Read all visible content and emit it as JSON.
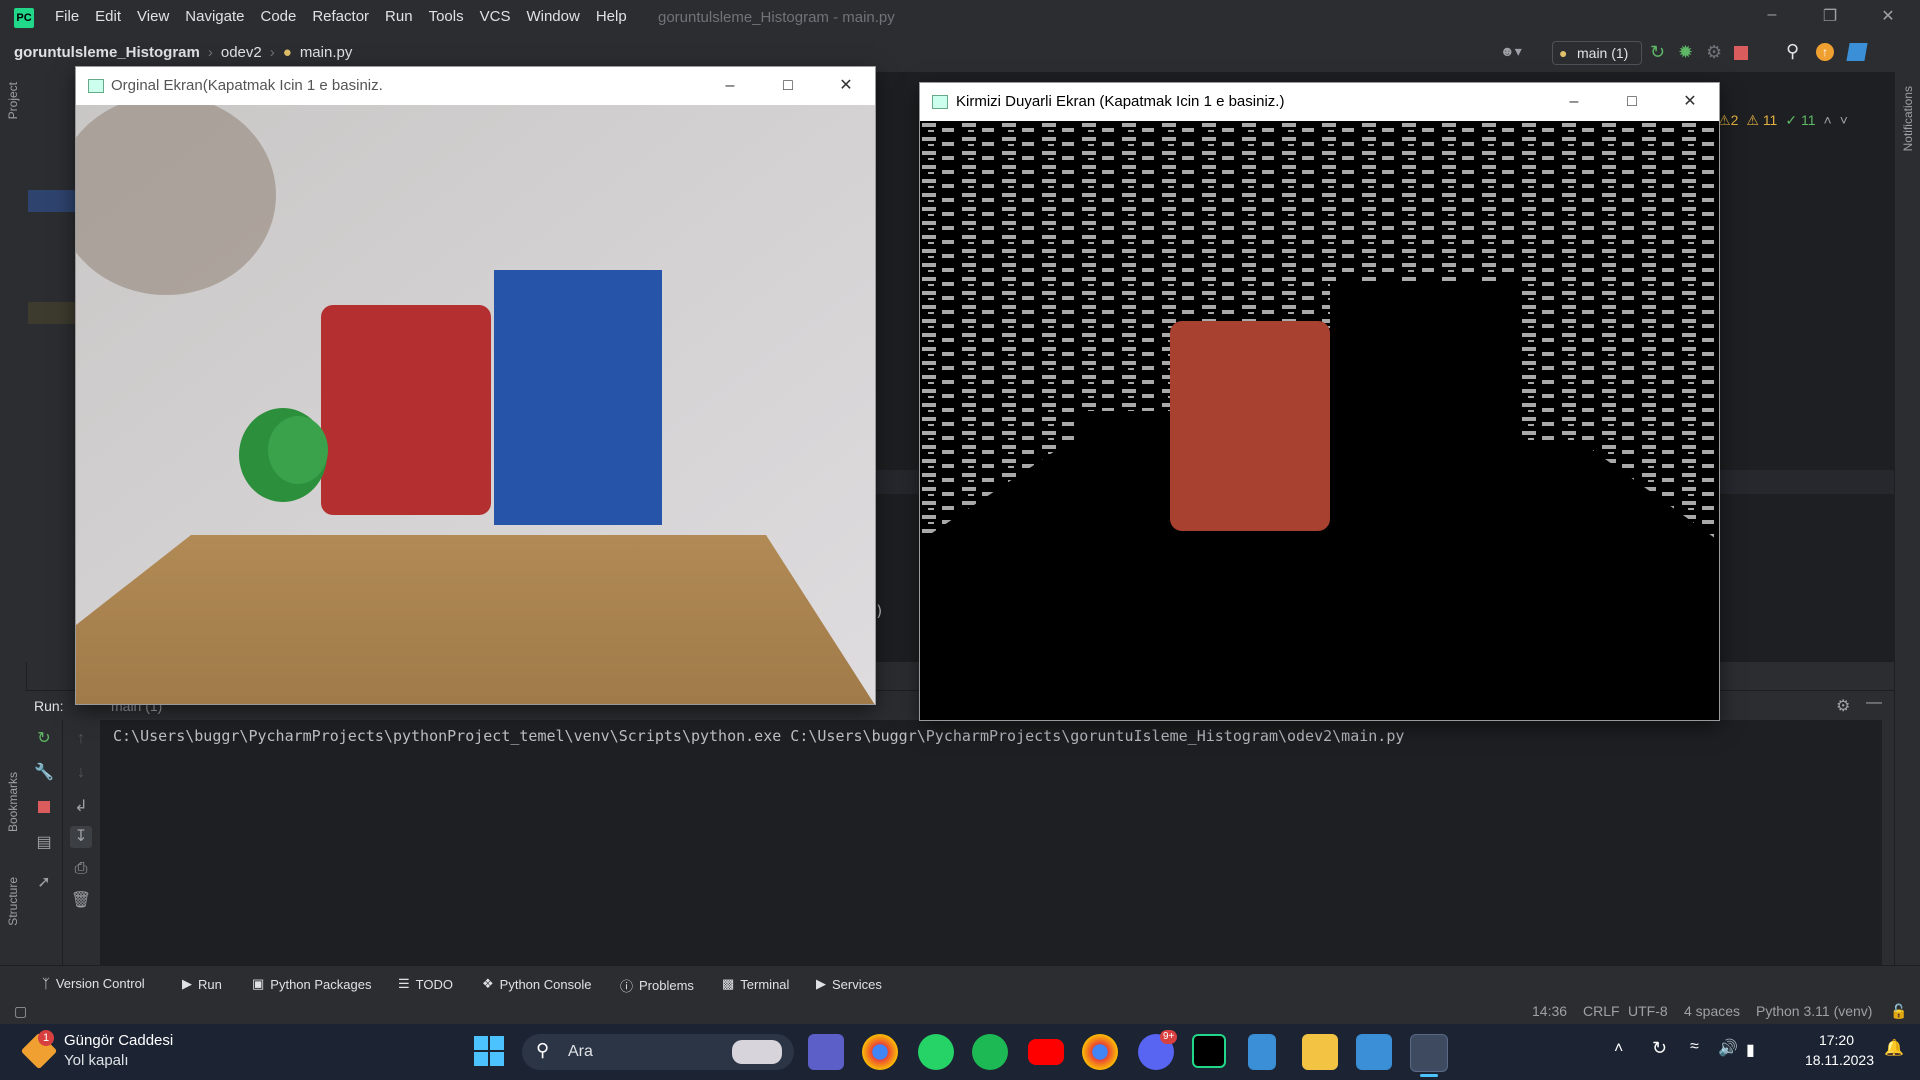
{
  "ide": {
    "menu": [
      "File",
      "Edit",
      "View",
      "Navigate",
      "Code",
      "Refactor",
      "Run",
      "Tools",
      "VCS",
      "Window",
      "Help"
    ],
    "window_title": "goruntulsleme_Histogram - main.py",
    "breadcrumb": {
      "project": "goruntulsleme_Histogram",
      "folder": "odev2",
      "file": "main.py"
    },
    "run_config": "main (1)",
    "inspection": {
      "errors": "2",
      "warnings": "11",
      "ok": "11"
    },
    "left_strip": {
      "project": "Project",
      "bookmarks": "Bookmarks",
      "structure": "Structure"
    },
    "right_strip": {
      "notifications": "Notifications"
    },
    "editor_fragment": "k)",
    "run_panel": {
      "label": "Run:",
      "tab": "main (1)",
      "console_line": "C:\\Users\\buggr\\PycharmProjects\\pythonProject_temel\\venv\\Scripts\\python.exe C:\\Users\\buggr\\PycharmProjects\\goruntuIsleme_Histogram\\odev2\\main.py"
    },
    "tool_tabs": [
      "Version Control",
      "Run",
      "Python Packages",
      "TODO",
      "Python Console",
      "Problems",
      "Terminal",
      "Services"
    ],
    "status": {
      "position": "14:36",
      "line_sep": "CRLF",
      "encoding": "UTF-8",
      "indent": "4 spaces",
      "interpreter": "Python 3.11 (venv)"
    }
  },
  "windows": {
    "original": {
      "title": "Orginal Ekran(Kapatmak Icin 1 e basiniz."
    },
    "red": {
      "title": "Kirmizi Duyarli Ekran (Kapatmak Icin 1 e basiniz.)"
    }
  },
  "taskbar": {
    "weather_title": "Güngör Caddesi",
    "weather_sub": "Yol kapalı",
    "weather_badge": "1",
    "search_placeholder": "Ara",
    "discord_badge": "9+",
    "time": "17:20",
    "date": "18.11.2023"
  },
  "colors": {
    "accent": "#21d789",
    "run_green": "#5fb865",
    "stop_red": "#db5c5c",
    "taskbar": "#1c2434"
  }
}
